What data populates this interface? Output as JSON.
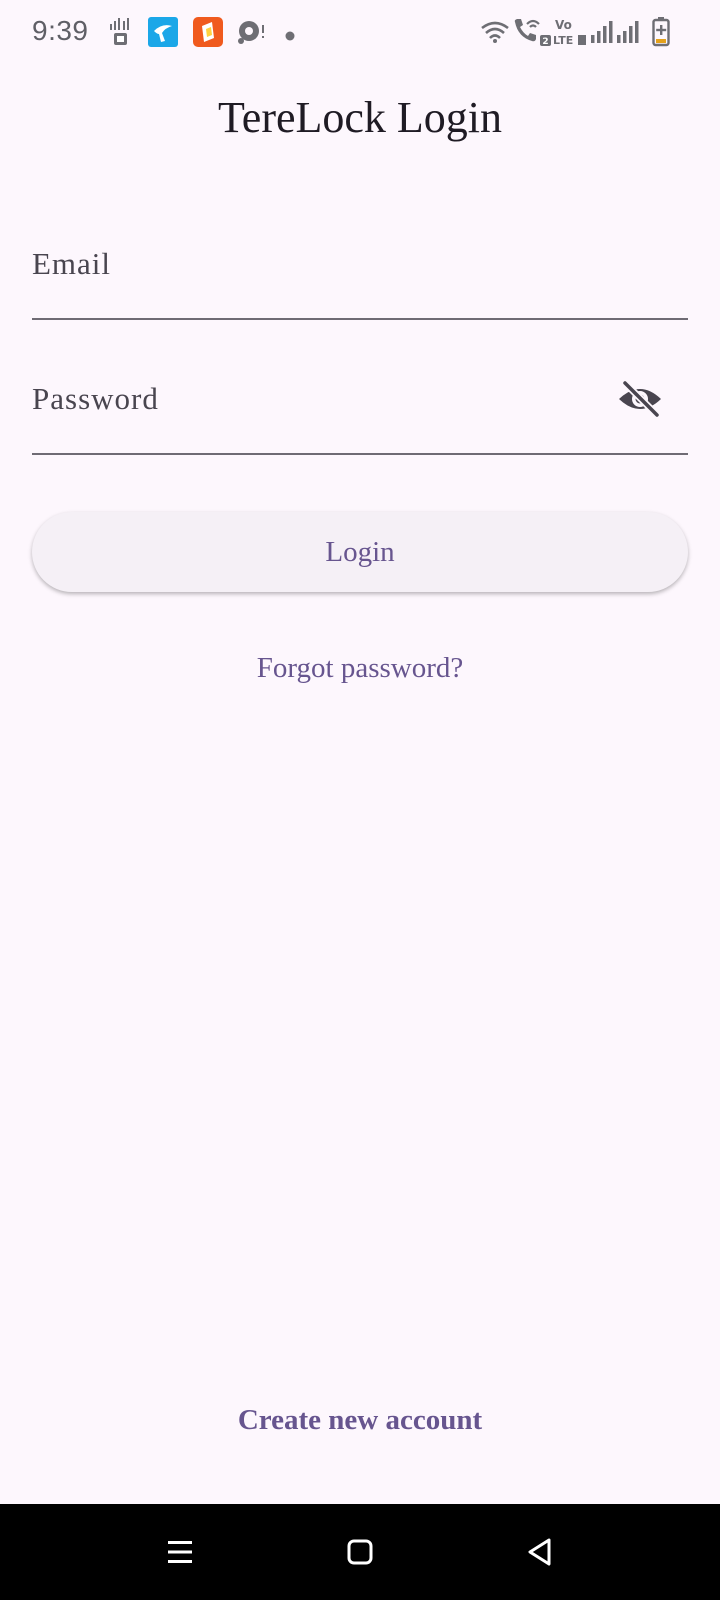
{
  "status_bar": {
    "time": "9:39",
    "left_icons": [
      "sim-data-icon",
      "grameenphone-app-icon",
      "orange-app-icon",
      "cast-icon",
      "notification-dot-icon"
    ],
    "right_icons": [
      "wifi-icon",
      "wifi-calling-icon",
      "volte-icon",
      "signal-1-icon",
      "signal-2-icon",
      "battery-charging-icon"
    ]
  },
  "login": {
    "title": "TereLock Login",
    "email_placeholder": "Email",
    "email_value": "",
    "password_placeholder": "Password",
    "password_value": "",
    "password_toggle_icon": "eye-off-icon",
    "login_button_label": "Login",
    "forgot_password_label": "Forgot password?",
    "create_account_label": "Create new account"
  },
  "nav_bar": {
    "buttons": [
      "recents-icon",
      "home-icon",
      "back-icon"
    ]
  },
  "colors": {
    "background": "#fdf7fd",
    "accent": "#67558f",
    "underline": "#6f6b74",
    "button_bg": "#f5f0f6"
  }
}
